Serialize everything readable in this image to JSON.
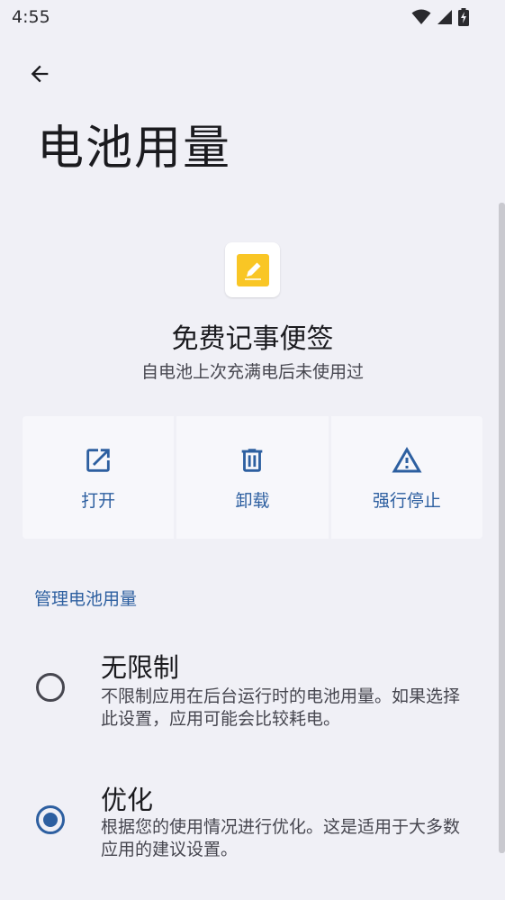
{
  "status_bar": {
    "time": "4:55",
    "icons": [
      "wifi-icon",
      "cellular-signal-icon",
      "battery-charging-icon"
    ]
  },
  "header": {
    "back_icon": "arrow-back-icon",
    "title": "电池用量"
  },
  "app": {
    "icon": "note-pencil-icon",
    "icon_color": "#f9c625",
    "name": "免费记事便签",
    "usage_status": "自电池上次充满电后未使用过"
  },
  "actions": [
    {
      "label": "打开",
      "icon": "open-external-icon"
    },
    {
      "label": "卸载",
      "icon": "trash-icon"
    },
    {
      "label": "强行停止",
      "icon": "warning-icon"
    }
  ],
  "section": {
    "title": "管理电池用量"
  },
  "options": [
    {
      "title": "无限制",
      "description": "不限制应用在后台运行时的电池用量。如果选择此设置，应用可能会比较耗电。",
      "selected": false
    },
    {
      "title": "优化",
      "description": "根据您的使用情况进行优化。这是适用于大多数应用的建议设置。",
      "selected": true
    }
  ],
  "colors": {
    "accent": "#2d5fa0",
    "background": "#f0f0f6",
    "text_primary": "#1b1b1f",
    "text_secondary": "#46464f"
  }
}
